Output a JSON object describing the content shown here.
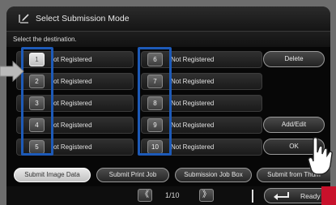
{
  "header": {
    "title": "Select Submission Mode",
    "icon": "pen-paper-icon"
  },
  "subheader": {
    "text": "Select the destination."
  },
  "left_rows": [
    {
      "num": "1",
      "label": "ot Registered",
      "selected": true
    },
    {
      "num": "2",
      "label": "ot Registered",
      "selected": false
    },
    {
      "num": "3",
      "label": "ot Registered",
      "selected": false
    },
    {
      "num": "4",
      "label": "ot Registered",
      "selected": false
    },
    {
      "num": "5",
      "label": "ot Registered",
      "selected": false
    }
  ],
  "right_rows": [
    {
      "num": "6",
      "label": "Not Registered"
    },
    {
      "num": "7",
      "label": "Not Registered"
    },
    {
      "num": "8",
      "label": "Not Registered"
    },
    {
      "num": "9",
      "label": "Not Registered"
    },
    {
      "num": "10",
      "label": "Not Registered"
    }
  ],
  "side_buttons": {
    "delete": "Delete",
    "add_edit": "Add/Edit",
    "ok": "OK"
  },
  "tabs": [
    {
      "label": "Submit Image Data",
      "active": true
    },
    {
      "label": "Submit Print Job",
      "active": false
    },
    {
      "label": "Submission Job Box",
      "active": false
    },
    {
      "label": "Submit from Thum",
      "active": false
    }
  ],
  "pagination": {
    "prev": "《",
    "next": "》",
    "text": "1/10"
  },
  "ready": {
    "label": "Ready",
    "icon": "return-arrow-icon"
  },
  "colors": {
    "highlight": "#1d5ab8",
    "background": "#070707",
    "accent_red": "#c8112b"
  }
}
